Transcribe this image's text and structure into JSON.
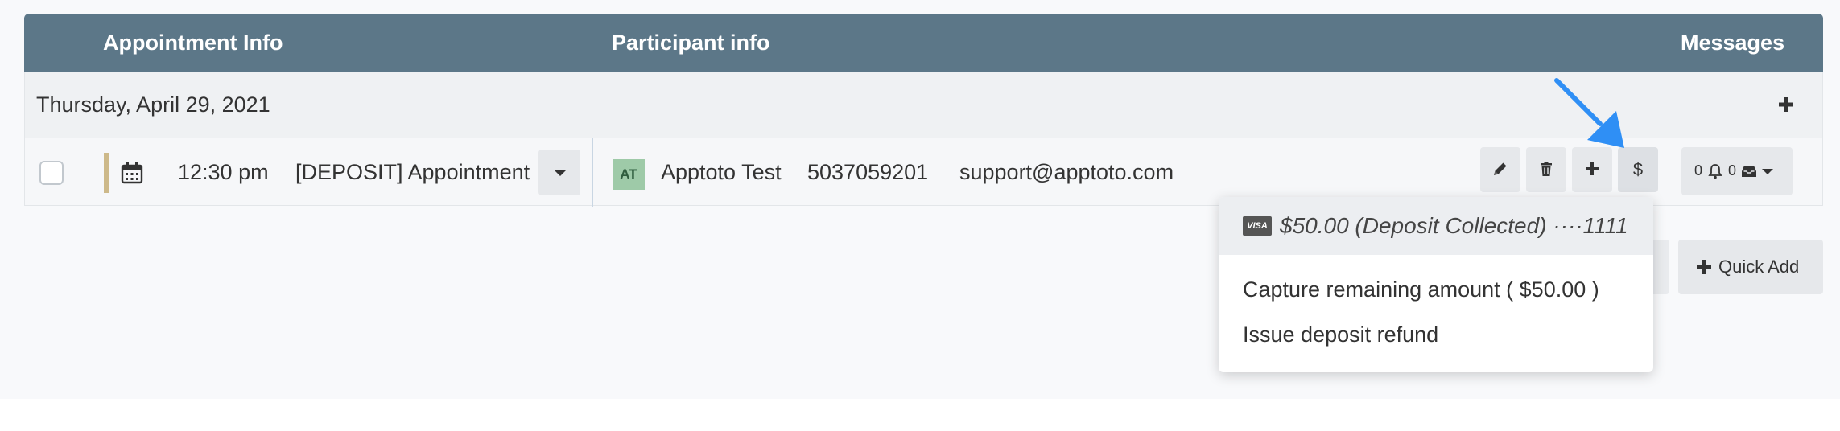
{
  "header": {
    "appointment_info": "Appointment Info",
    "participant_info": "Participant info",
    "messages": "Messages"
  },
  "date_row": {
    "date": "Thursday, April 29, 2021",
    "add_icon": "plus-icon"
  },
  "appointment": {
    "time": "12:30 pm",
    "title": "[DEPOSIT] Appointment",
    "color": "#cdb98a",
    "calendar_icon": "calendar-icon",
    "participant": {
      "initials": "AT",
      "name": "Apptoto Test",
      "phone": "5037059201",
      "email": "support@apptoto.com"
    },
    "actions": [
      "pencil-icon",
      "trash-icon",
      "plus-icon",
      "dollar-icon"
    ],
    "dollar_symbol": "$",
    "messages": {
      "count_1": "0",
      "count_2": "0",
      "icons": [
        "bell-icon",
        "inbox-icon",
        "caret-down-icon"
      ]
    }
  },
  "payment_dropdown": {
    "card_brand": "VISA",
    "summary": "$50.00 (Deposit Collected) ····1111",
    "items": [
      "Capture remaining amount ( $50.00 )",
      "Issue deposit refund"
    ]
  },
  "quick_add": {
    "label": "Quick Add"
  },
  "colors": {
    "header_bg": "#5c7788",
    "date_row_bg": "#eff1f3",
    "button_bg": "#e6e8eb",
    "annotation_arrow": "#2f8ff5",
    "avatar_bg": "#9ecaa8"
  }
}
